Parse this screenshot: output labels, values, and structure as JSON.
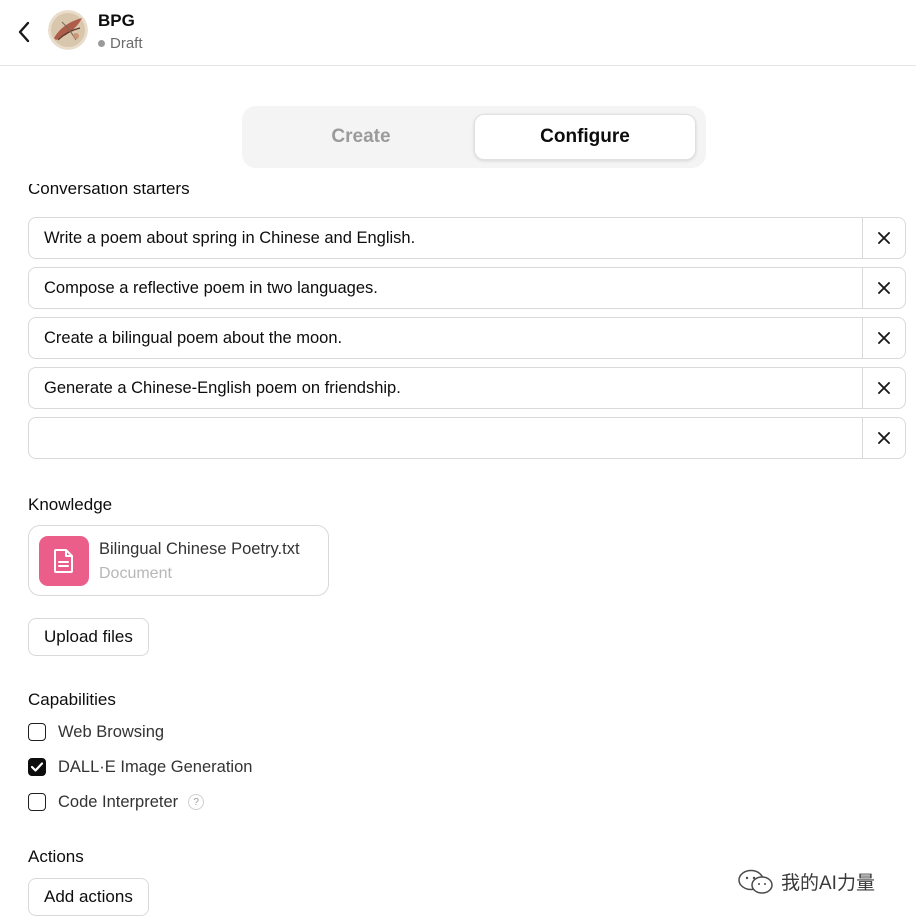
{
  "header": {
    "title": "BPG",
    "status": "Draft"
  },
  "tabs": [
    {
      "label": "Create",
      "active": false
    },
    {
      "label": "Configure",
      "active": true
    }
  ],
  "conversation_starters": {
    "label": "Conversation starters",
    "items": [
      "Write a poem about spring in Chinese and English.",
      "Compose a reflective poem in two languages.",
      "Create a bilingual poem about the moon.",
      "Generate a Chinese-English poem on friendship.",
      ""
    ]
  },
  "knowledge": {
    "label": "Knowledge",
    "file": {
      "name": "Bilingual Chinese Poetry.txt",
      "type": "Document",
      "icon": "document-icon",
      "color": "#ec5e8a"
    },
    "upload_label": "Upload files"
  },
  "capabilities": {
    "label": "Capabilities",
    "items": [
      {
        "label": "Web Browsing",
        "checked": false
      },
      {
        "label": "DALL·E Image Generation",
        "checked": true
      },
      {
        "label": "Code Interpreter",
        "checked": false,
        "help": "?"
      }
    ]
  },
  "actions": {
    "label": "Actions",
    "add_label": "Add actions"
  },
  "watermark": {
    "text": "我的AI力量",
    "icon": "wechat-icon"
  }
}
